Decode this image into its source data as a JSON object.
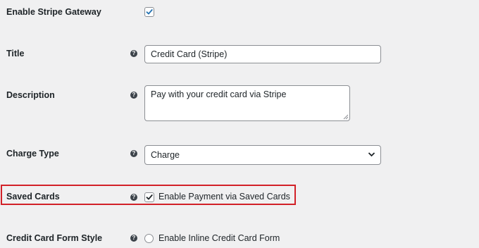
{
  "settings": {
    "enable_gateway": {
      "label": "Enable Stripe Gateway",
      "checked": true
    },
    "title": {
      "label": "Title",
      "value": "Credit Card (Stripe)"
    },
    "description": {
      "label": "Description",
      "value": "Pay with your credit card via Stripe"
    },
    "charge_type": {
      "label": "Charge Type",
      "selected": "Charge"
    },
    "saved_cards": {
      "label": "Saved Cards",
      "option_label": "Enable Payment via Saved Cards",
      "checked": true
    },
    "card_form_style": {
      "label": "Credit Card Form Style",
      "option_label": "Enable Inline Credit Card Form",
      "selected": false
    }
  },
  "help_glyph": "?",
  "colors": {
    "background": "#f0f0f1",
    "highlight": "#d22128",
    "checkmark": "#2271b1",
    "text": "#1d2327"
  }
}
